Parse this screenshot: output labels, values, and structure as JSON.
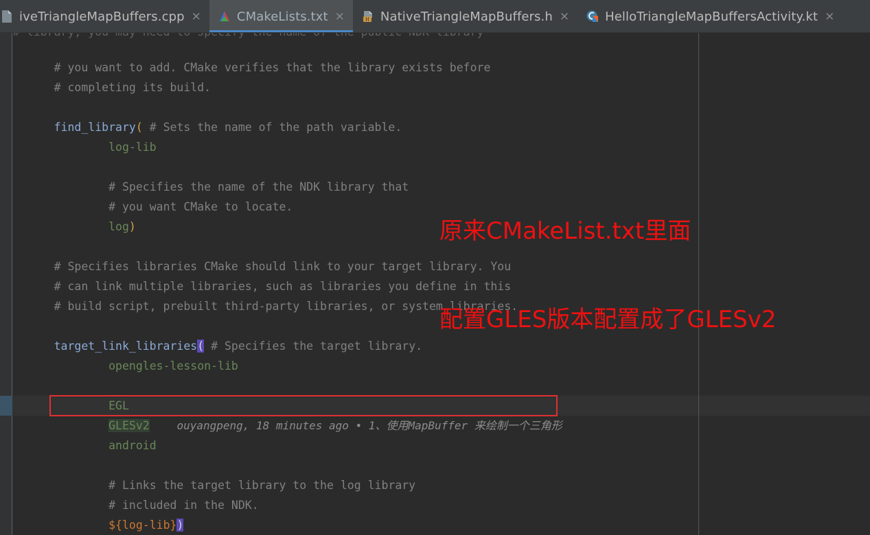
{
  "window": {
    "app": "Android Studio editor",
    "theme_background": "#2b2b2b",
    "accent": "#4a88c7"
  },
  "tabs": [
    {
      "label": "iveTriangleMapBuffers.cpp",
      "icon": "cpp-file-icon",
      "active": false,
      "close_glyph": "×",
      "clipped": true
    },
    {
      "label": "CMakeLists.txt",
      "icon": "cmake-triangle-icon",
      "active": true,
      "close_glyph": "×",
      "clipped": false
    },
    {
      "label": "NativeTriangleMapBuffers.h",
      "icon": "header-file-icon",
      "active": false,
      "close_glyph": "×",
      "clipped": false
    },
    {
      "label": "HelloTriangleMapBuffersActivity.kt",
      "icon": "kotlin-class-icon",
      "active": false,
      "close_glyph": "×",
      "clipped": false
    }
  ],
  "editor": {
    "clipped_top_line": "# library, you may need to specify the name of the public NDK library",
    "lines": [
      {
        "id": "l1",
        "text": "# you want to add. CMake verifies that the library exists before",
        "kind": "comment"
      },
      {
        "id": "l2",
        "text": "# completing its build.",
        "kind": "comment"
      },
      {
        "id": "l3",
        "text": "",
        "kind": "blank"
      },
      {
        "id": "l4",
        "text": "find_library( # Sets the name of the path variable.",
        "kind": "call-open"
      },
      {
        "id": "l5",
        "text": "        log-lib",
        "kind": "string"
      },
      {
        "id": "l6",
        "text": "",
        "kind": "blank"
      },
      {
        "id": "l7",
        "text": "        # Specifies the name of the NDK library that",
        "kind": "comment"
      },
      {
        "id": "l8",
        "text": "        # you want CMake to locate.",
        "kind": "comment"
      },
      {
        "id": "l9",
        "text": "        log)",
        "kind": "string-close"
      },
      {
        "id": "l10",
        "text": "",
        "kind": "blank"
      },
      {
        "id": "l11",
        "text": "# Specifies libraries CMake should link to your target library. You",
        "kind": "comment"
      },
      {
        "id": "l12",
        "text": "# can link multiple libraries, such as libraries you define in this",
        "kind": "comment"
      },
      {
        "id": "l13",
        "text": "# build script, prebuilt third-party libraries, or system libraries.",
        "kind": "comment"
      },
      {
        "id": "l14",
        "text": "",
        "kind": "blank"
      },
      {
        "id": "l15",
        "text": "target_link_libraries( # Specifies the target library.",
        "kind": "call-open-match"
      },
      {
        "id": "l16",
        "text": "        opengles-lesson-lib",
        "kind": "string"
      },
      {
        "id": "l17",
        "text": "",
        "kind": "blank"
      },
      {
        "id": "l18",
        "text": "        EGL",
        "kind": "string"
      },
      {
        "id": "l19",
        "text": "        GLESv2",
        "kind": "string-highlighted"
      },
      {
        "id": "l20",
        "text": "        android",
        "kind": "string"
      },
      {
        "id": "l21",
        "text": "",
        "kind": "blank"
      },
      {
        "id": "l22",
        "text": "        # Links the target library to the log library",
        "kind": "comment"
      },
      {
        "id": "l23",
        "text": "        # included in the NDK.",
        "kind": "comment"
      },
      {
        "id": "l24",
        "text": "        ${log-lib})",
        "kind": "var-close-match"
      }
    ],
    "tokens": {
      "find_library_fn": "find_library",
      "find_library_comment": "# Sets the name of the path variable.",
      "log_lib_value": "log-lib",
      "ndk_comment_1": "# Specifies the name of the NDK library that",
      "ndk_comment_2": "# you want CMake to locate.",
      "log_value": "log",
      "target_link_fn": "target_link_libraries",
      "target_link_comment": "# Specifies the target library.",
      "lib_opengles": "opengles-lesson-lib",
      "lib_egl": "EGL",
      "lib_glesv2": "GLESv2",
      "lib_android": "android",
      "links_comment_1": "# Links the target library to the log library",
      "links_comment_2": "# included in the NDK.",
      "log_lib_ref": "${log-lib}",
      "open_paren": "(",
      "close_paren": ")"
    },
    "blame_annotation": "ouyangpeng, 18 minutes ago • 1、使用MapBuffer 来绘制一个三角形",
    "colors": {
      "comment": "#808080",
      "function": "#8caad7",
      "paren": "#d4a24a",
      "string": "#6a8759",
      "variable": "#cc7832",
      "brace_match": "#5b4ab5",
      "caret_line_bg": "#323232",
      "change_marker": "#3b5567",
      "glesv2_highlight": "#344134"
    }
  },
  "annotation": {
    "color": "#ee1111",
    "line1": "原来CMakeList.txt里面",
    "line2": "配置GLES版本配置成了GLESv2"
  }
}
